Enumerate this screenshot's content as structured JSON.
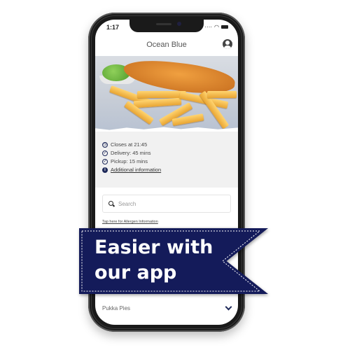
{
  "status_bar": {
    "time": "1:17",
    "signal": "····",
    "wifi_icon": "wifi-icon",
    "battery_icon": "battery-icon"
  },
  "header": {
    "title": "Ocean Blue",
    "account_icon": "account-circle-icon"
  },
  "hero": {
    "alt": "Fish and chips with mushy peas"
  },
  "info": {
    "closes": {
      "icon": "clock-icon",
      "text": "Closes at 21:45"
    },
    "delivery": {
      "icon": "check-circle-icon",
      "text": "Delivery: 45 mins"
    },
    "pickup": {
      "icon": "check-circle-icon",
      "text": "Pickup: 15 mins"
    },
    "additional": {
      "icon": "info-icon",
      "text": "Additional information"
    }
  },
  "search": {
    "placeholder": "Search",
    "icon": "search-icon"
  },
  "allergen_link": "Tap here for Allergen Information",
  "menu_categories": [
    {
      "label": "Pukka Pies",
      "icon": "chevron-down-icon"
    }
  ],
  "banner": {
    "text": "Easier with\nour app",
    "color": "#141b5a"
  }
}
